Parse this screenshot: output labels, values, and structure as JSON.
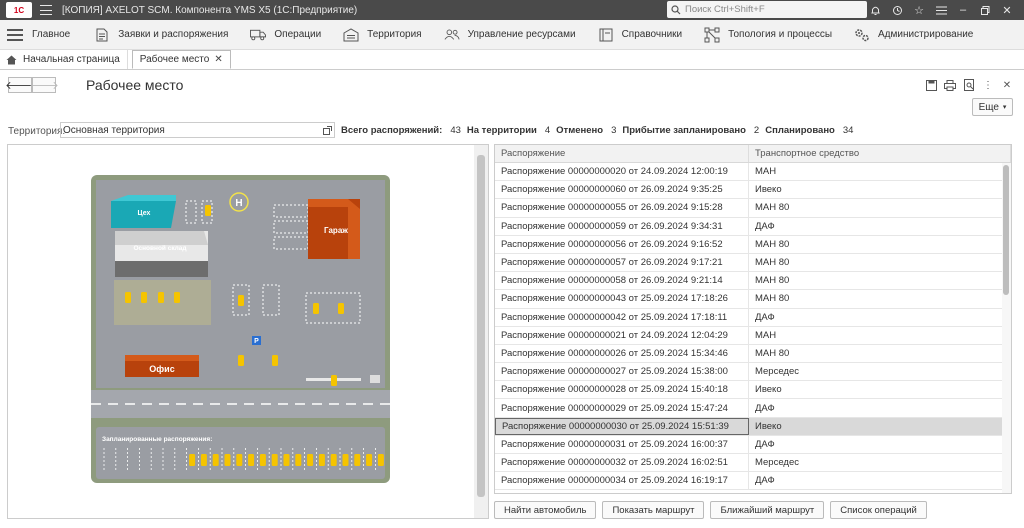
{
  "titlebar": {
    "logo": "1С",
    "title": "[КОПИЯ] AXELOT SCM. Компонента YMS X5  (1С:Предприятие)",
    "search_placeholder": "Поиск Ctrl+Shift+F"
  },
  "sections": [
    {
      "label": "Главное",
      "icon": "home-lines-icon"
    },
    {
      "label": "Заявки и распоряжения",
      "icon": "document-icon"
    },
    {
      "label": "Операции",
      "icon": "truck-icon"
    },
    {
      "label": "Территория",
      "icon": "warehouse-icon"
    },
    {
      "label": "Управление ресурсами",
      "icon": "people-icon"
    },
    {
      "label": "Справочники",
      "icon": "book-icon"
    },
    {
      "label": "Топология и процессы",
      "icon": "topology-icon"
    },
    {
      "label": "Администрирование",
      "icon": "gears-icon"
    }
  ],
  "tabs": {
    "home": "Начальная страница",
    "active": "Рабочее место"
  },
  "form": {
    "title": "Рабочее место",
    "more": "Еще"
  },
  "territory": {
    "label": "Территория:",
    "value": "Основная территория"
  },
  "stats": [
    {
      "label": "Всего распоряжений:",
      "value": "43"
    },
    {
      "label": "На территории",
      "value": "4"
    },
    {
      "label": "Отменено",
      "value": "3"
    },
    {
      "label": "Прибытие запланировано",
      "value": "2"
    },
    {
      "label": "Спланировано",
      "value": "34"
    }
  ],
  "map": {
    "workshop": "Цех",
    "warehouse": "Основной склад",
    "garage": "Гараж",
    "office": "Офис",
    "helipad": "H",
    "parking": "P",
    "planned": "Запланированные распоряжения:"
  },
  "grid": {
    "columns": [
      "Распоряжение",
      "Транспортное средство"
    ],
    "rows": [
      [
        "Распоряжение 00000000020 от 24.09.2024 12:00:19",
        "МАН"
      ],
      [
        "Распоряжение 00000000060 от 26.09.2024 9:35:25",
        "Ивеко"
      ],
      [
        "Распоряжение 00000000055 от 26.09.2024 9:15:28",
        "МАН 80"
      ],
      [
        "Распоряжение 00000000059 от 26.09.2024 9:34:31",
        "ДАФ"
      ],
      [
        "Распоряжение 00000000056 от 26.09.2024 9:16:52",
        "МАН 80"
      ],
      [
        "Распоряжение 00000000057 от 26.09.2024 9:17:21",
        "МАН 80"
      ],
      [
        "Распоряжение 00000000058 от 26.09.2024 9:21:14",
        "МАН 80"
      ],
      [
        "Распоряжение 00000000043 от 25.09.2024 17:18:26",
        "МАН 80"
      ],
      [
        "Распоряжение 00000000042 от 25.09.2024 17:18:11",
        "ДАФ"
      ],
      [
        "Распоряжение 00000000021 от 24.09.2024 12:04:29",
        "МАН"
      ],
      [
        "Распоряжение 00000000026 от 25.09.2024 15:34:46",
        "МАН 80"
      ],
      [
        "Распоряжение 00000000027 от 25.09.2024 15:38:00",
        "Мерседес"
      ],
      [
        "Распоряжение 00000000028 от 25.09.2024 15:40:18",
        "Ивеко"
      ],
      [
        "Распоряжение 00000000029 от 25.09.2024 15:47:24",
        "ДАФ"
      ],
      [
        "Распоряжение 00000000030 от 25.09.2024 15:51:39",
        "Ивеко"
      ],
      [
        "Распоряжение 00000000031 от 25.09.2024 16:00:37",
        "ДАФ"
      ],
      [
        "Распоряжение 00000000032 от 25.09.2024 16:02:51",
        "Мерседес"
      ],
      [
        "Распоряжение 00000000034 от 25.09.2024 16:19:17",
        "ДАФ"
      ]
    ],
    "selected_index": 14
  },
  "buttons": [
    "Найти автомобиль",
    "Показать маршрут",
    "Ближайший маршрут",
    "Список операций"
  ]
}
